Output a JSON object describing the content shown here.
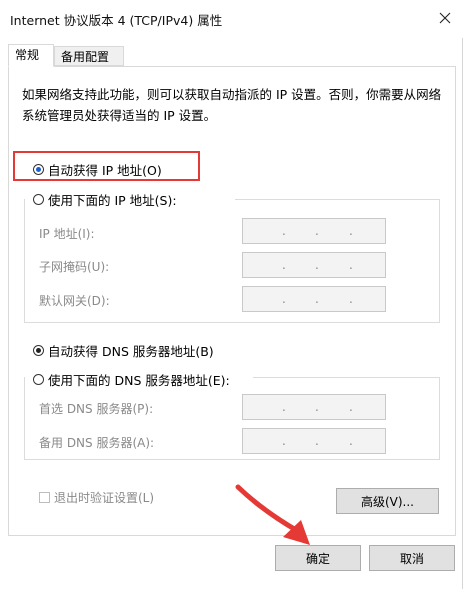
{
  "window": {
    "title": "Internet 协议版本 4 (TCP/IPv4) 属性"
  },
  "tabs": [
    {
      "label": "常规",
      "active": true
    },
    {
      "label": "备用配置",
      "active": false
    }
  ],
  "description": "如果网络支持此功能，则可以获取自动指派的 IP 设置。否则，你需要从网络系统管理员处获得适当的 IP 设置。",
  "ip_section": {
    "auto_label": "自动获得 IP 地址(O)",
    "auto_selected": true,
    "manual_label": "使用下面的 IP 地址(S):",
    "fields": [
      {
        "label": "IP 地址(I):"
      },
      {
        "label": "子网掩码(U):"
      },
      {
        "label": "默认网关(D):"
      }
    ]
  },
  "dns_section": {
    "auto_label": "自动获得 DNS 服务器地址(B)",
    "auto_selected": true,
    "manual_label": "使用下面的 DNS 服务器地址(E):",
    "fields": [
      {
        "label": "首选 DNS 服务器(P):"
      },
      {
        "label": "备用 DNS 服务器(A):"
      }
    ]
  },
  "validate_on_exit": {
    "label": "退出时验证设置(L)",
    "checked": false,
    "enabled": false
  },
  "buttons": {
    "advanced": "高级(V)...",
    "ok": "确定",
    "cancel": "取消"
  },
  "icons": {
    "close": "close-icon",
    "annotation_arrow": "arrow-icon"
  },
  "colors": {
    "highlight": "#e53935",
    "arrow": "#e53935",
    "radio_selected": "#1a5fd1"
  }
}
